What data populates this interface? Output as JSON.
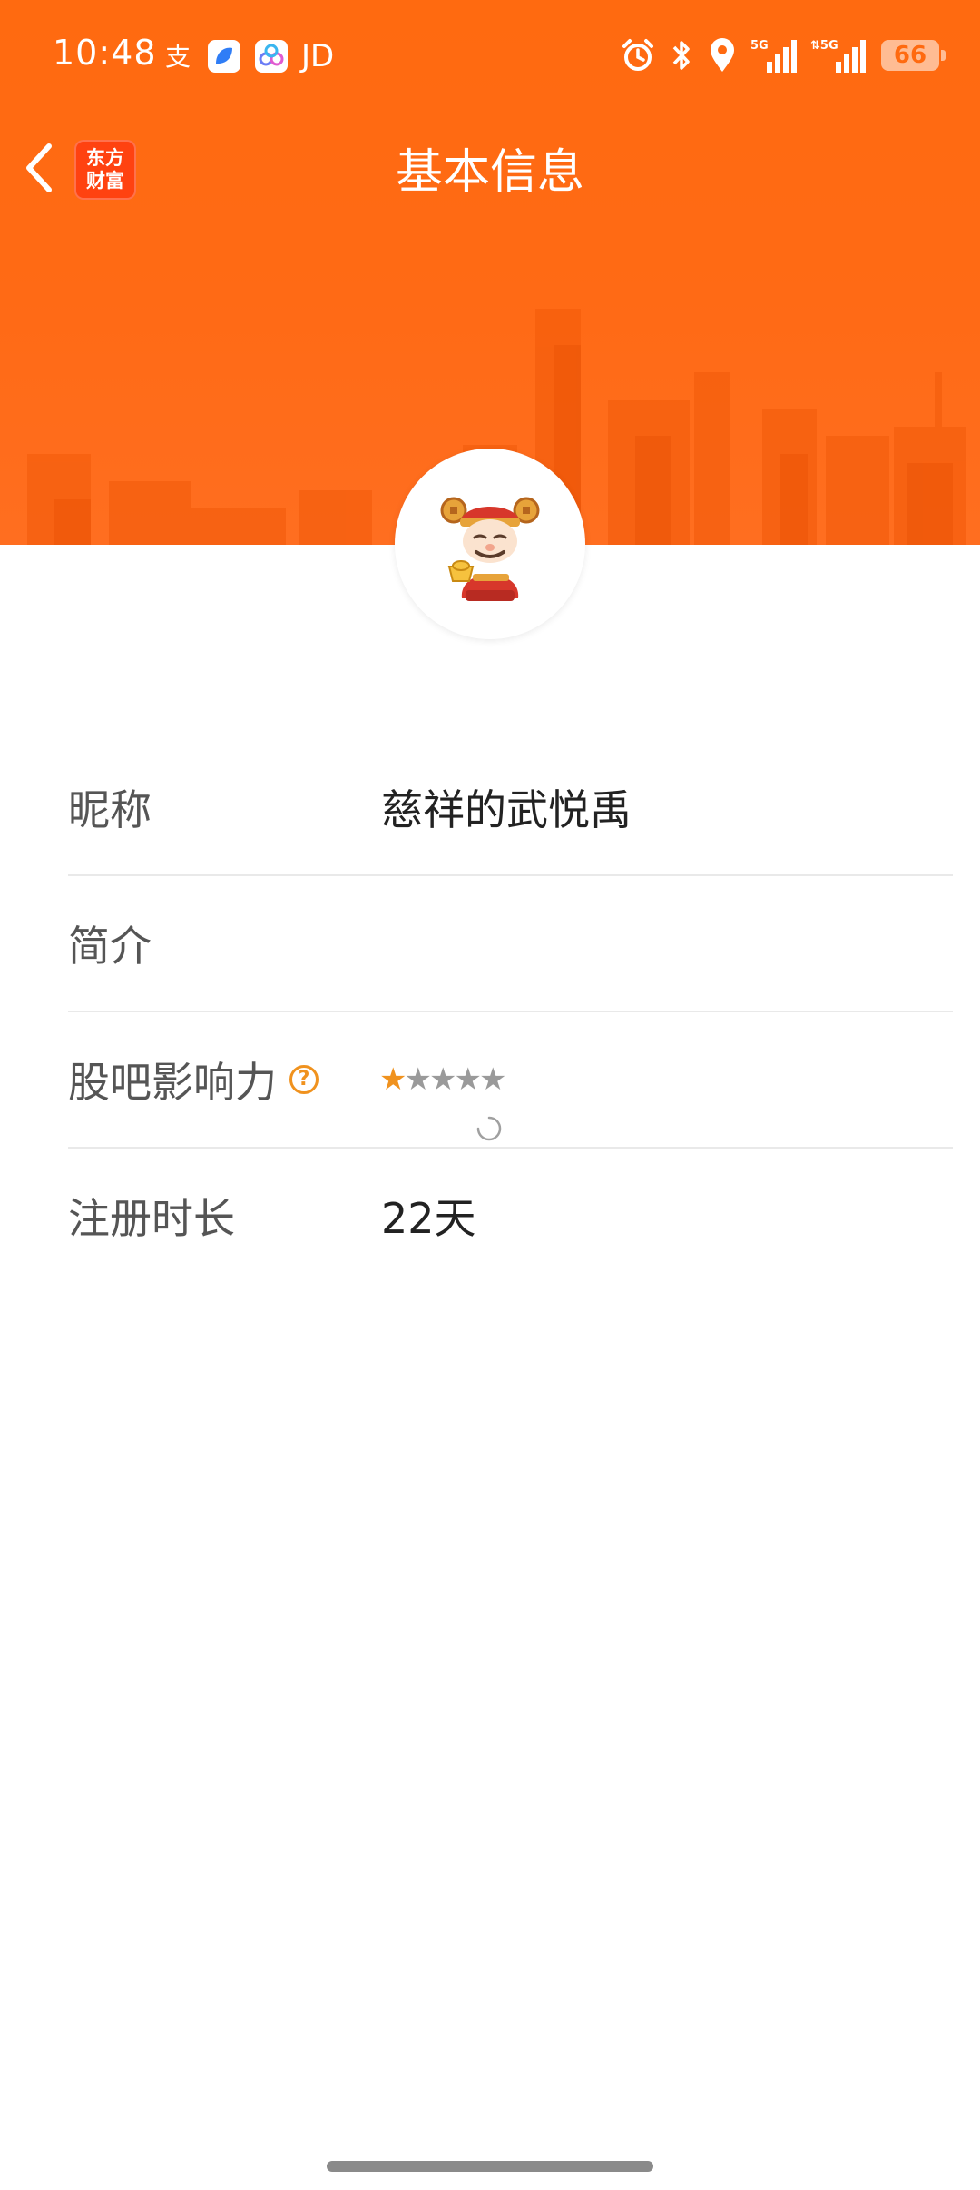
{
  "status_bar": {
    "time": "10:48",
    "left_icons": [
      "alipay-icon",
      "blue-app-icon",
      "cloud-app-icon"
    ],
    "jd_label": "JD",
    "right_icons": [
      "alarm-icon",
      "bluetooth-icon",
      "location-icon",
      "signal-5g-icon",
      "signal-5g-icon"
    ],
    "battery_level": "66"
  },
  "nav": {
    "title": "基本信息",
    "logo_line1": "东方",
    "logo_line2": "财富"
  },
  "profile": {
    "avatar_icon": "caishen-avatar-icon",
    "fields": {
      "nickname_label": "昵称",
      "nickname_value": "慈祥的武悦禹",
      "intro_label": "简介",
      "intro_value": "",
      "influence_label": "股吧影响力",
      "influence_stars": 1,
      "influence_max_stars": 5,
      "duration_label": "注册时长",
      "duration_value": "22天"
    }
  },
  "colors": {
    "header_orange": "#ff6a10",
    "accent_orange": "#f0921e",
    "logo_red": "#ff4210"
  }
}
